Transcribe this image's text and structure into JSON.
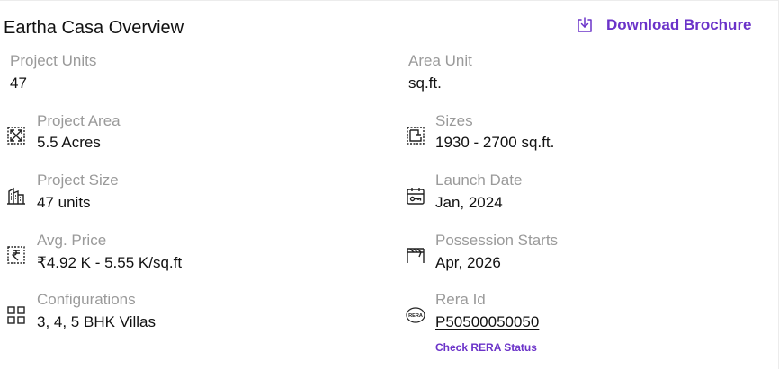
{
  "header": {
    "title": "Eartha Casa Overview",
    "download_label": "Download Brochure",
    "accent_color": "#6b33c9"
  },
  "details": {
    "project_units": {
      "label": "Project Units",
      "value": "47"
    },
    "area_unit": {
      "label": "Area Unit",
      "value": "sq.ft."
    },
    "project_area": {
      "label": "Project Area",
      "value": "5.5 Acres",
      "icon": "expand-area-icon"
    },
    "sizes": {
      "label": "Sizes",
      "value": "1930 - 2700 sq.ft.",
      "icon": "floorplan-icon"
    },
    "project_size": {
      "label": "Project Size",
      "value": "47 units",
      "icon": "buildings-icon"
    },
    "launch_date": {
      "label": "Launch Date",
      "value": "Jan, 2024",
      "icon": "calendar-key-icon"
    },
    "avg_price": {
      "label": "Avg. Price",
      "value": "₹4.92 K - 5.55 K/sq.ft",
      "icon": "rupee-icon"
    },
    "possession": {
      "label": "Possession Starts",
      "value": "Apr, 2026",
      "icon": "possession-gate-icon"
    },
    "configurations": {
      "label": "Configurations",
      "value": "3, 4, 5 BHK Villas",
      "icon": "grid-icon"
    },
    "rera": {
      "label": "Rera Id",
      "value": "P50500050050",
      "icon_text": "RERA",
      "check_label": "Check RERA Status"
    }
  }
}
